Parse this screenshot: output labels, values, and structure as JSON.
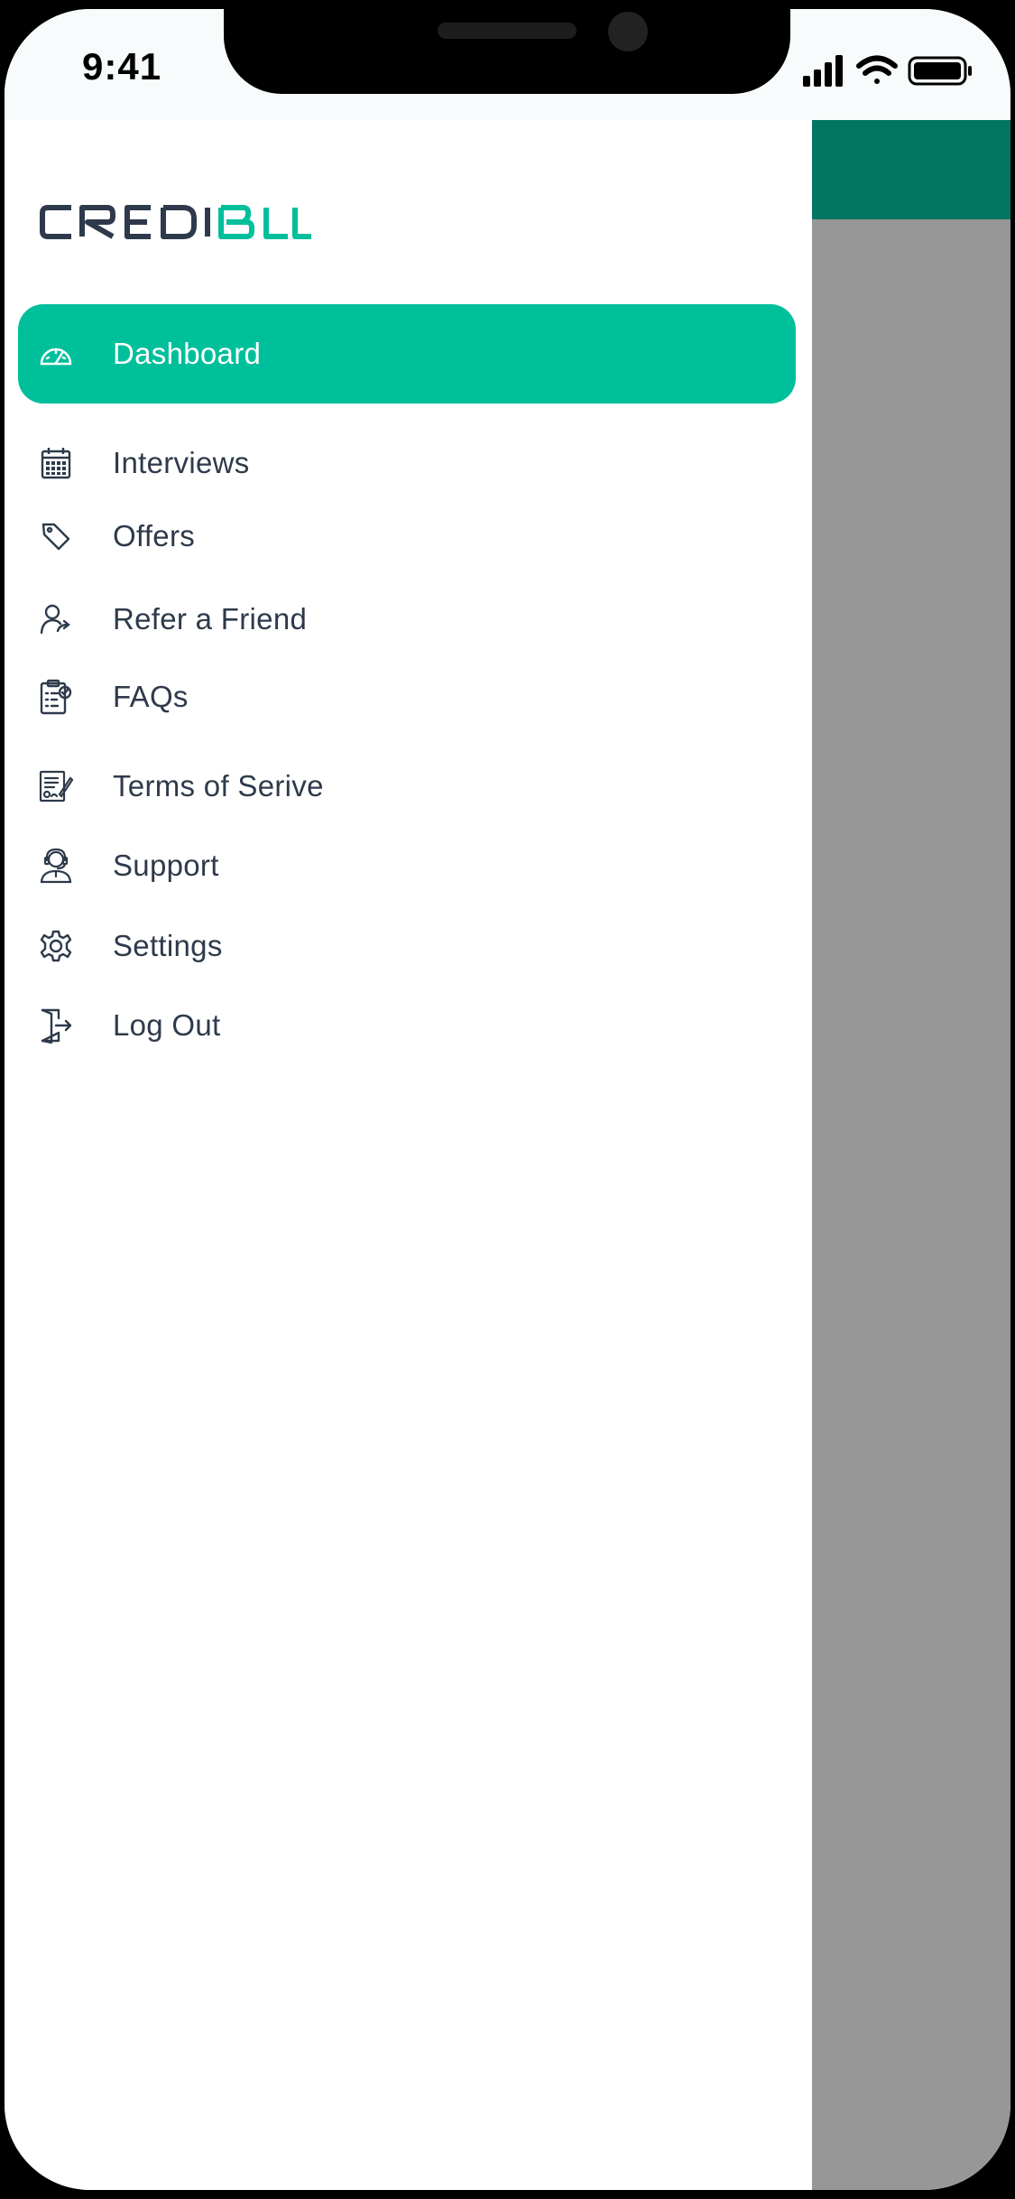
{
  "status_bar": {
    "time": "9:41"
  },
  "brand": {
    "logo_text_dark": "CREDI",
    "logo_text_accent": "BLL",
    "accent_color": "#00bf9b",
    "dark_color": "#2e3a4b"
  },
  "menu": {
    "items": [
      {
        "label": "Dashboard",
        "icon": "speedometer-icon",
        "active": true
      },
      {
        "label": "Interviews",
        "icon": "calendar-icon"
      },
      {
        "label": "Offers",
        "icon": "tag-icon"
      },
      {
        "label": "Refer a Friend",
        "icon": "user-share-icon"
      },
      {
        "label": "FAQs",
        "icon": "clipboard-check-icon"
      },
      {
        "label": "Terms of Serive",
        "icon": "document-sign-icon"
      },
      {
        "label": "Support",
        "icon": "headset-agent-icon"
      },
      {
        "label": "Settings",
        "icon": "gear-icon"
      },
      {
        "label": "Log Out",
        "icon": "logout-door-icon"
      }
    ]
  },
  "colors": {
    "active_bg": "#00bf9b",
    "header_green": "#007561",
    "overlay_gray": "#979797"
  }
}
